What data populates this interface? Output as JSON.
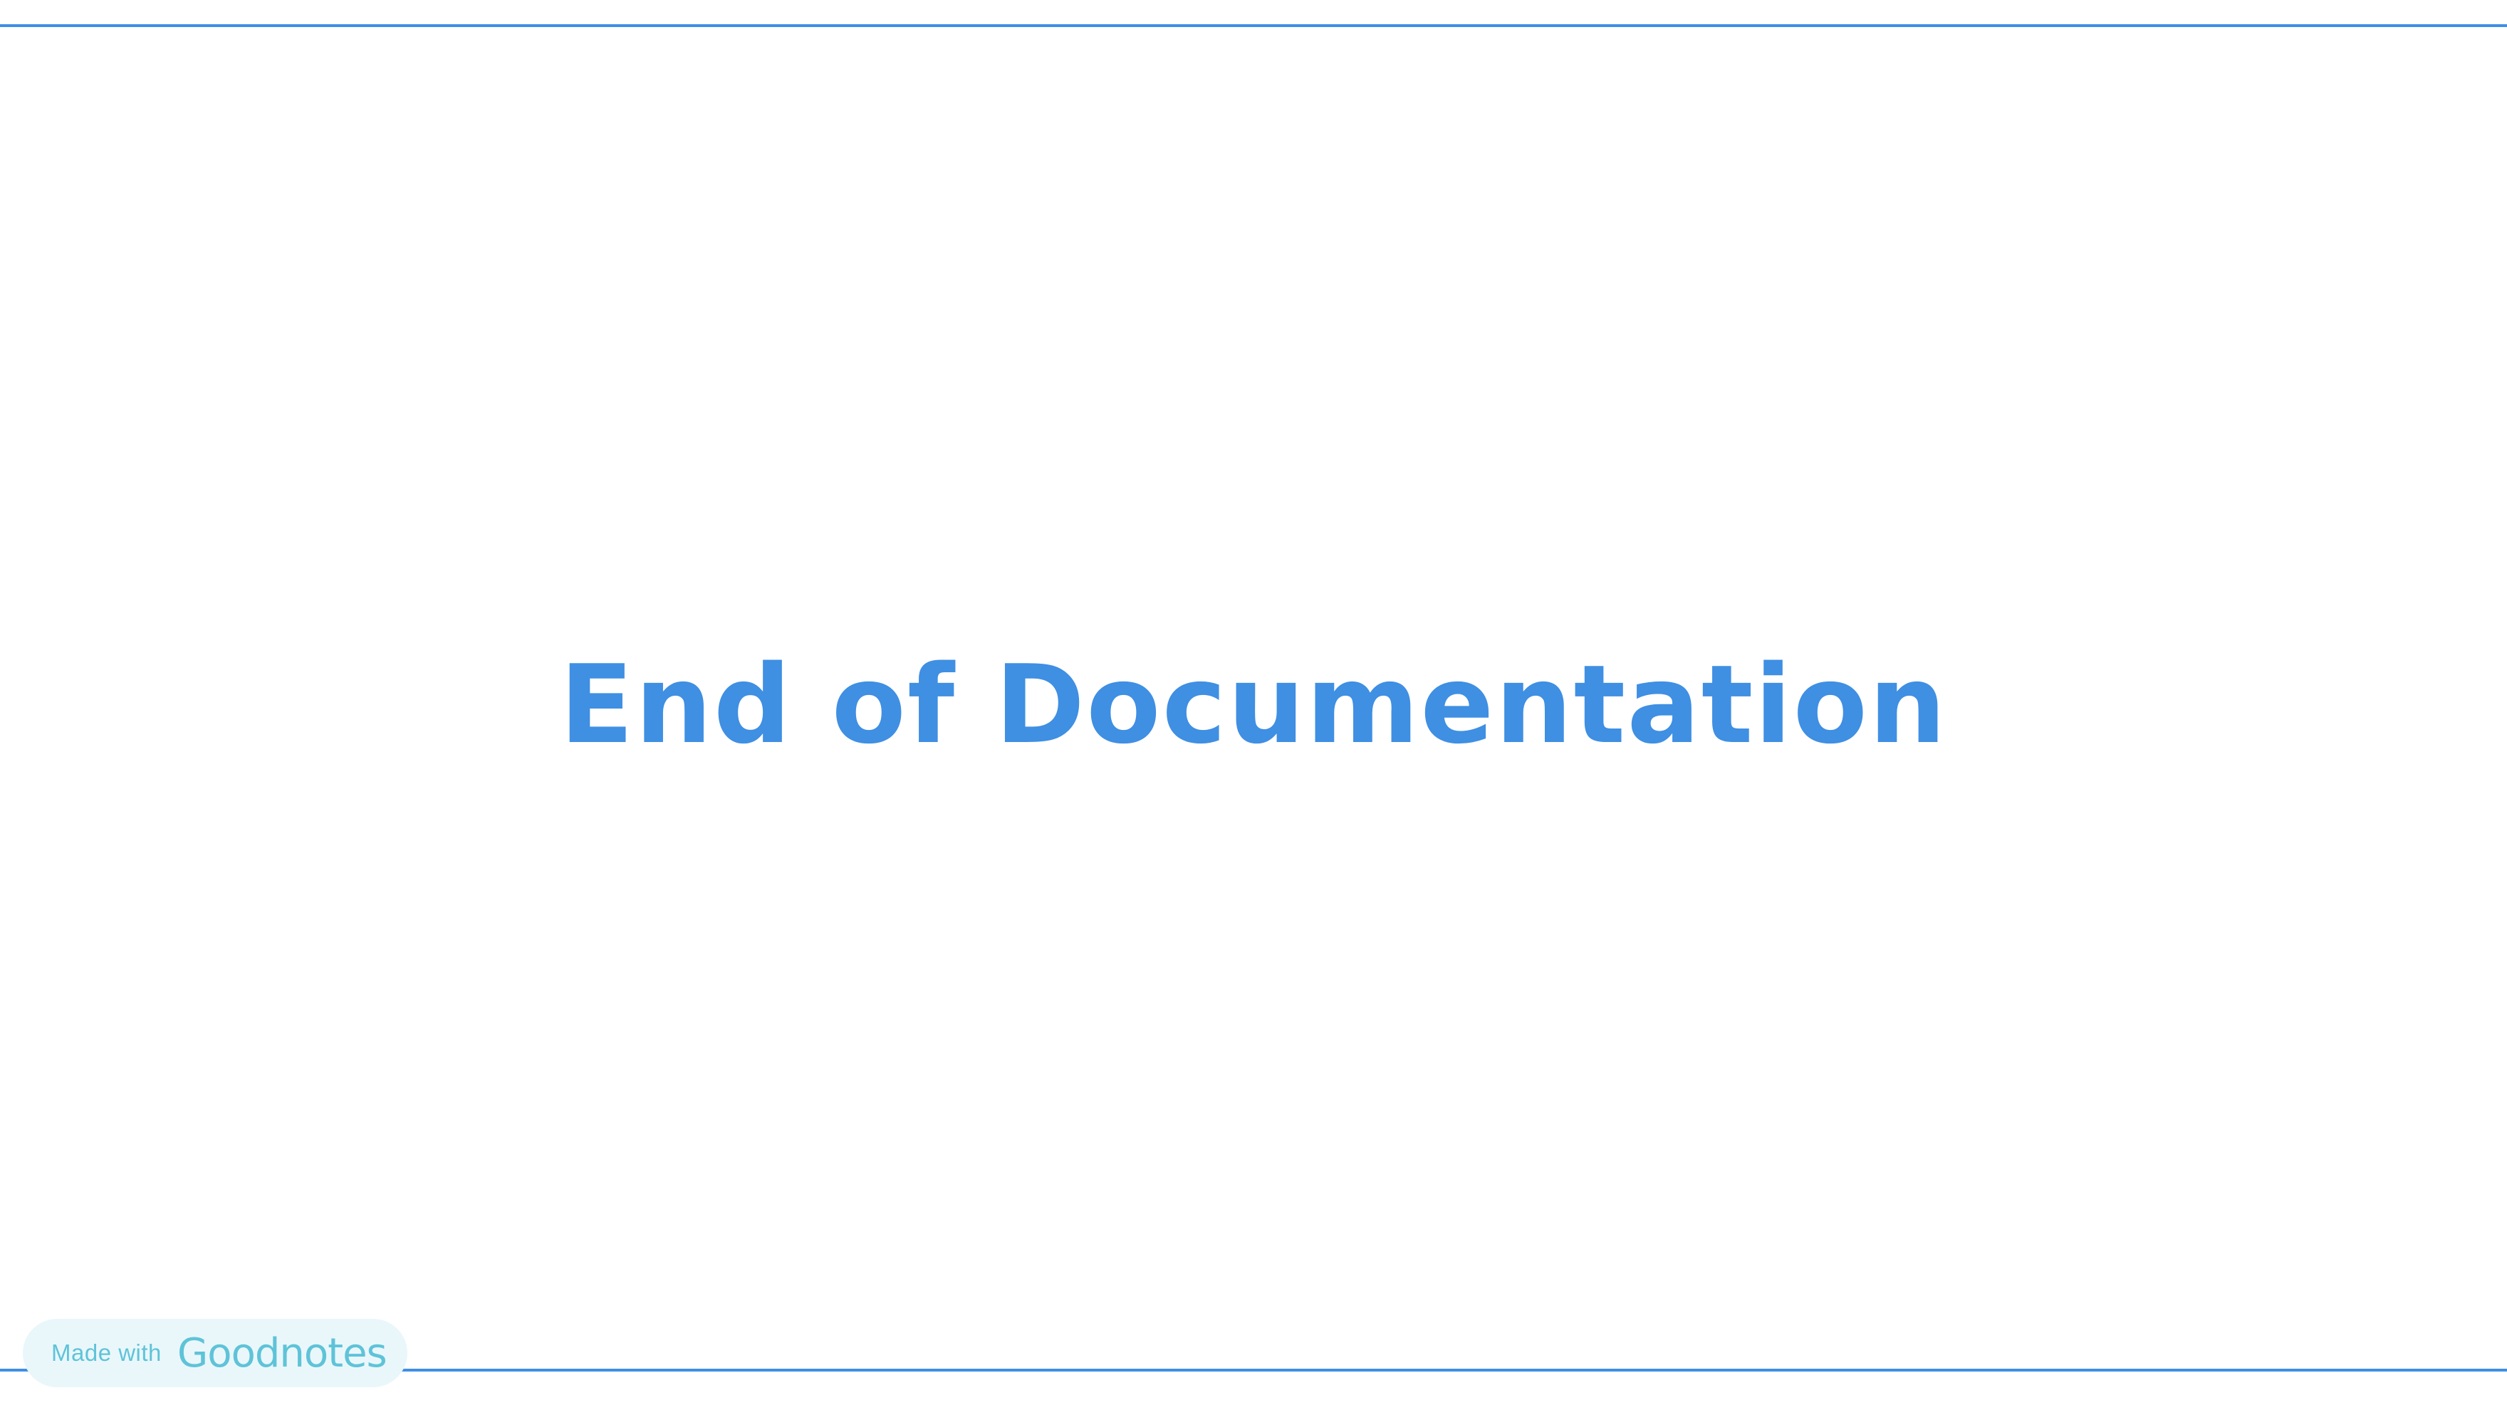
{
  "document": {
    "title": "End of Documentation"
  },
  "badge": {
    "made_with": "Made with",
    "brand": "Goodnotes"
  },
  "colors": {
    "accent": "#3f8fe3",
    "rule": "#3f8fe3",
    "badge_background": "#e9f7fb",
    "badge_text": "#5fc3d8"
  }
}
